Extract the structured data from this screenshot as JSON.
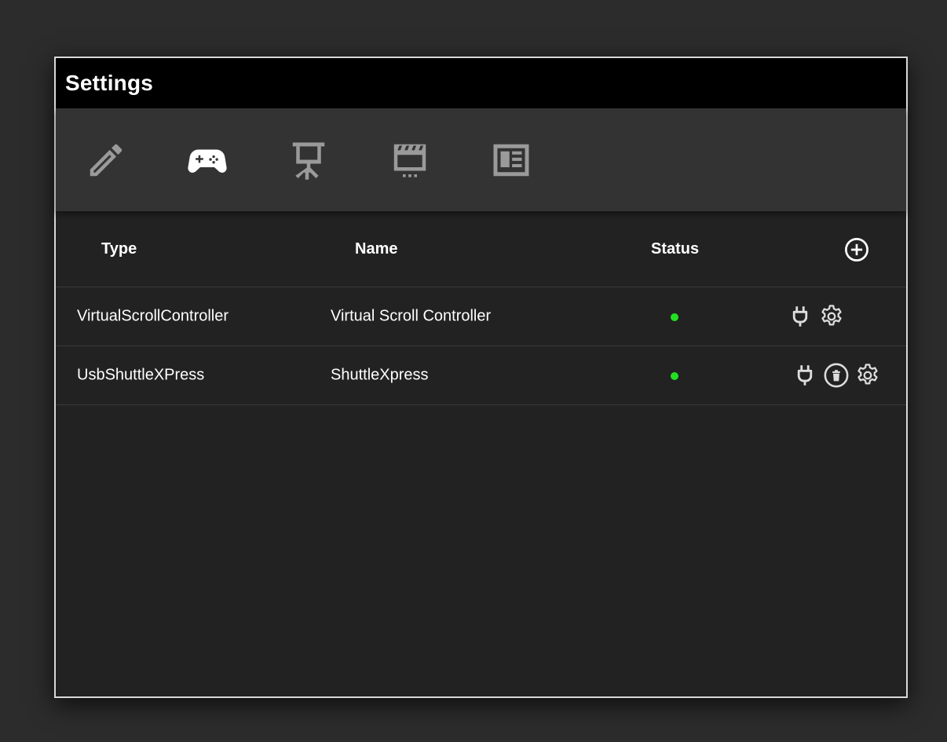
{
  "dialog": {
    "title": "Settings"
  },
  "toolbar": {
    "tabs": [
      {
        "icon": "pencil-icon",
        "label": "Edit",
        "active": false
      },
      {
        "icon": "gamepad-icon",
        "label": "Controllers",
        "active": true
      },
      {
        "icon": "presentation-icon",
        "label": "Presentation",
        "active": false
      },
      {
        "icon": "clapperboard-icon",
        "label": "Media",
        "active": false
      },
      {
        "icon": "article-icon",
        "label": "Layout",
        "active": false
      }
    ]
  },
  "table": {
    "columns": {
      "type": "Type",
      "name": "Name",
      "status": "Status"
    },
    "add_icon": "plus-circle-icon",
    "rows": [
      {
        "type": "VirtualScrollController",
        "name": "Virtual Scroll Controller",
        "status": "connected",
        "actions": [
          "plug-icon",
          "gear-icon"
        ]
      },
      {
        "type": "UsbShuttleXPress",
        "name": "ShuttleXpress",
        "status": "connected",
        "actions": [
          "plug-icon",
          "delete-icon",
          "gear-icon"
        ]
      }
    ]
  },
  "colors": {
    "background": "#2c2c2c",
    "titlebar": "#000000",
    "toolbar": "#333333",
    "panel": "#222222",
    "icon_inactive": "#9a9a9a",
    "icon_active": "#ffffff",
    "status_connected": "#22e022",
    "border": "#d9d9d9"
  }
}
